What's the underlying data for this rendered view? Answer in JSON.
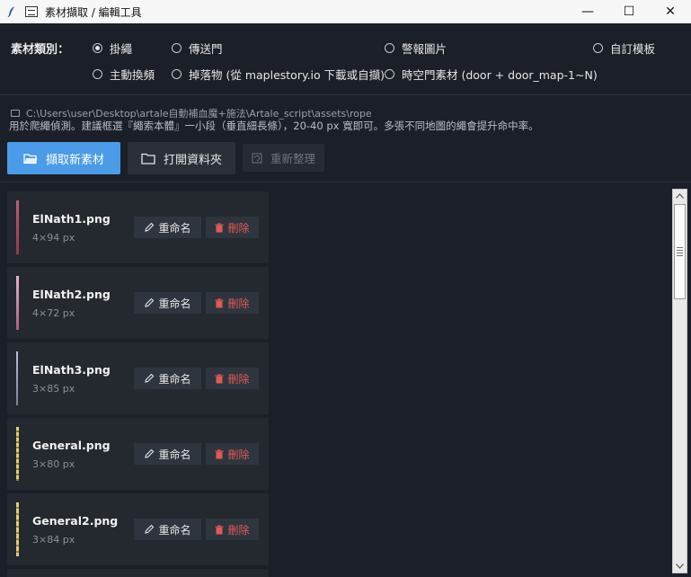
{
  "window": {
    "title": "素材擷取 / 編輯工具",
    "minimize": "—",
    "maximize": "☐",
    "close": "✕"
  },
  "category": {
    "label": "素材類別：",
    "options": [
      {
        "label": "掛繩",
        "checked": true
      },
      {
        "label": "傳送門",
        "checked": false
      },
      {
        "label": "警報圖片",
        "checked": false
      },
      {
        "label": "自訂模板",
        "checked": false
      },
      {
        "label": "主動換頻",
        "checked": false
      },
      {
        "label": "掉落物 (從 maplestory.io 下載或自擷)",
        "checked": false
      },
      {
        "label": "時空門素材 (door + door_map-1~N)",
        "checked": false
      }
    ]
  },
  "path": "C:\\Users\\user\\Desktop\\artale自動補血魔+施法\\Artale_script\\assets\\rope",
  "hint": "用於爬繩偵測。建議框選『繩索本體』一小段（垂直細長條），20-40 px 寬即可。多張不同地圖的繩會提升命中率。",
  "buttons": {
    "capture": "擷取新素材",
    "open_folder": "打開資料夾",
    "reorganize": "重新整理"
  },
  "items": [
    {
      "name": "ElNath1.png",
      "dims": "4×94 px",
      "thumb_color": "#c35a78",
      "rename": "重命名",
      "delete": "刪除"
    },
    {
      "name": "ElNath2.png",
      "dims": "4×72 px",
      "thumb_color": "#d7a3b8",
      "rename": "重命名",
      "delete": "刪除"
    },
    {
      "name": "ElNath3.png",
      "dims": "3×85 px",
      "thumb_color": "#a8b0c4",
      "rename": "重命名",
      "delete": "刪除"
    },
    {
      "name": "General.png",
      "dims": "3×80 px",
      "thumb_color": "#d8c36a",
      "rename": "重命名",
      "delete": "刪除"
    },
    {
      "name": "General2.png",
      "dims": "3×84 px",
      "thumb_color": "#d8c36a",
      "rename": "重命名",
      "delete": "刪除"
    }
  ]
}
